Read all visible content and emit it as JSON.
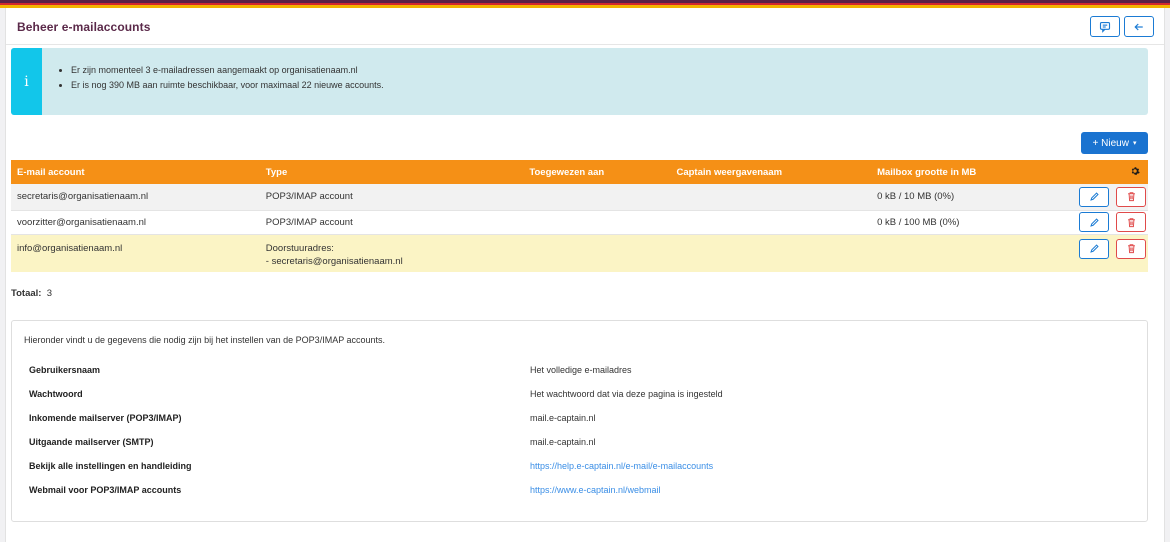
{
  "page": {
    "title": "Beheer e-mailaccounts"
  },
  "header_buttons": [
    {
      "icon": "comment-icon"
    },
    {
      "icon": "arrow-left-icon"
    }
  ],
  "info": {
    "icon": "i",
    "lines": [
      "Er zijn momenteel 3 e-mailadressen aangemaakt op organisatienaam.nl",
      "Er is nog 390 MB aan ruimte beschikbaar, voor maximaal 22 nieuwe accounts."
    ]
  },
  "toolbar": {
    "new_label": "+ Nieuw",
    "new_caret": "▾"
  },
  "table": {
    "columns": [
      "E-mail account",
      "Type",
      "Toegewezen aan",
      "Captain weergavenaam",
      "Mailbox grootte in MB"
    ],
    "settings_icon": "gear-icon",
    "rows": [
      {
        "account": "secretaris@organisatienaam.nl",
        "type": "POP3/IMAP account",
        "type2": "",
        "assigned": "",
        "captain": "",
        "size": "0 kB / 10 MB (0%)"
      },
      {
        "account": "voorzitter@organisatienaam.nl",
        "type": "POP3/IMAP account",
        "type2": "",
        "assigned": "",
        "captain": "",
        "size": "0 kB / 100 MB (0%)"
      },
      {
        "account": "info@organisatienaam.nl",
        "type": "Doorstuuradres:",
        "type2": "- secretaris@organisatienaam.nl",
        "assigned": "",
        "captain": "",
        "size": ""
      }
    ]
  },
  "totaal": {
    "label": "Totaal:",
    "value": "3"
  },
  "settings": {
    "intro": "Hieronder vindt u de gegevens die nodig zijn bij het instellen van de POP3/IMAP accounts.",
    "rows": [
      {
        "key": "Gebruikersnaam",
        "value": "Het volledige e-mailadres"
      },
      {
        "key": "Wachtwoord",
        "value": "Het wachtwoord dat via deze pagina is ingesteld"
      },
      {
        "key": "Inkomende mailserver (POP3/IMAP)",
        "value": "mail.e-captain.nl"
      },
      {
        "key": "Uitgaande mailserver (SMTP)",
        "value": "mail.e-captain.nl"
      },
      {
        "key": "Bekijk alle instellingen en handleiding",
        "value": "https://help.e-captain.nl/e-mail/e-mailaccounts"
      },
      {
        "key": "Webmail voor POP3/IMAP accounts",
        "value": "https://www.e-captain.nl/webmail"
      }
    ]
  },
  "colors": {
    "accent": "#1a73d0",
    "table_header": "#f59016",
    "info_bg": "#d0eaee",
    "info_bar": "#12c6ea",
    "highlight_row": "#fbf4c5",
    "title": "#5b2a4a",
    "danger": "#e04a4a"
  }
}
